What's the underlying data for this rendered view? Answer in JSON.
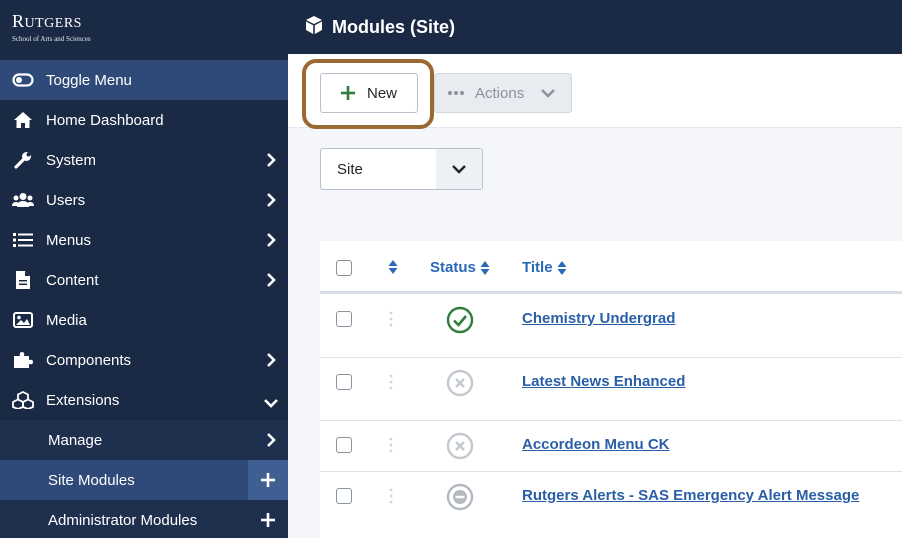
{
  "logo": {
    "brand_first": "R",
    "brand_rest": "UTGERS",
    "subtitle": "School of Arts and Sciences"
  },
  "sidebar": {
    "items": [
      {
        "label": "Toggle Menu",
        "icon": "toggle-icon"
      },
      {
        "label": "Home Dashboard",
        "icon": "home-icon"
      },
      {
        "label": "System",
        "icon": "wrench-icon"
      },
      {
        "label": "Users",
        "icon": "users-icon"
      },
      {
        "label": "Menus",
        "icon": "list-icon"
      },
      {
        "label": "Content",
        "icon": "file-icon"
      },
      {
        "label": "Media",
        "icon": "image-icon"
      },
      {
        "label": "Components",
        "icon": "puzzle-icon"
      },
      {
        "label": "Extensions",
        "icon": "cubes-icon"
      }
    ],
    "subitems": [
      {
        "label": "Manage"
      },
      {
        "label": "Site Modules"
      },
      {
        "label": "Administrator Modules"
      }
    ]
  },
  "header": {
    "title": "Modules (Site)",
    "icon": "cube-icon"
  },
  "toolbar": {
    "new_label": "New",
    "actions_label": "Actions"
  },
  "filter": {
    "client_value": "Site"
  },
  "table": {
    "headers": {
      "status": "Status",
      "title": "Title"
    },
    "rows": [
      {
        "title": "Chemistry Undergrad",
        "status": "published"
      },
      {
        "title": "Latest News Enhanced",
        "status": "unpublished"
      },
      {
        "title": "Accordeon Menu CK",
        "status": "unpublished"
      },
      {
        "title": "Rutgers Alerts - SAS Emergency Alert Message",
        "status": "trashed"
      }
    ]
  },
  "colors": {
    "sidebar_bg": "#1b2a44",
    "accent": "#2a69b8",
    "highlight": "#9b6a33",
    "published": "#2f7d3a"
  }
}
